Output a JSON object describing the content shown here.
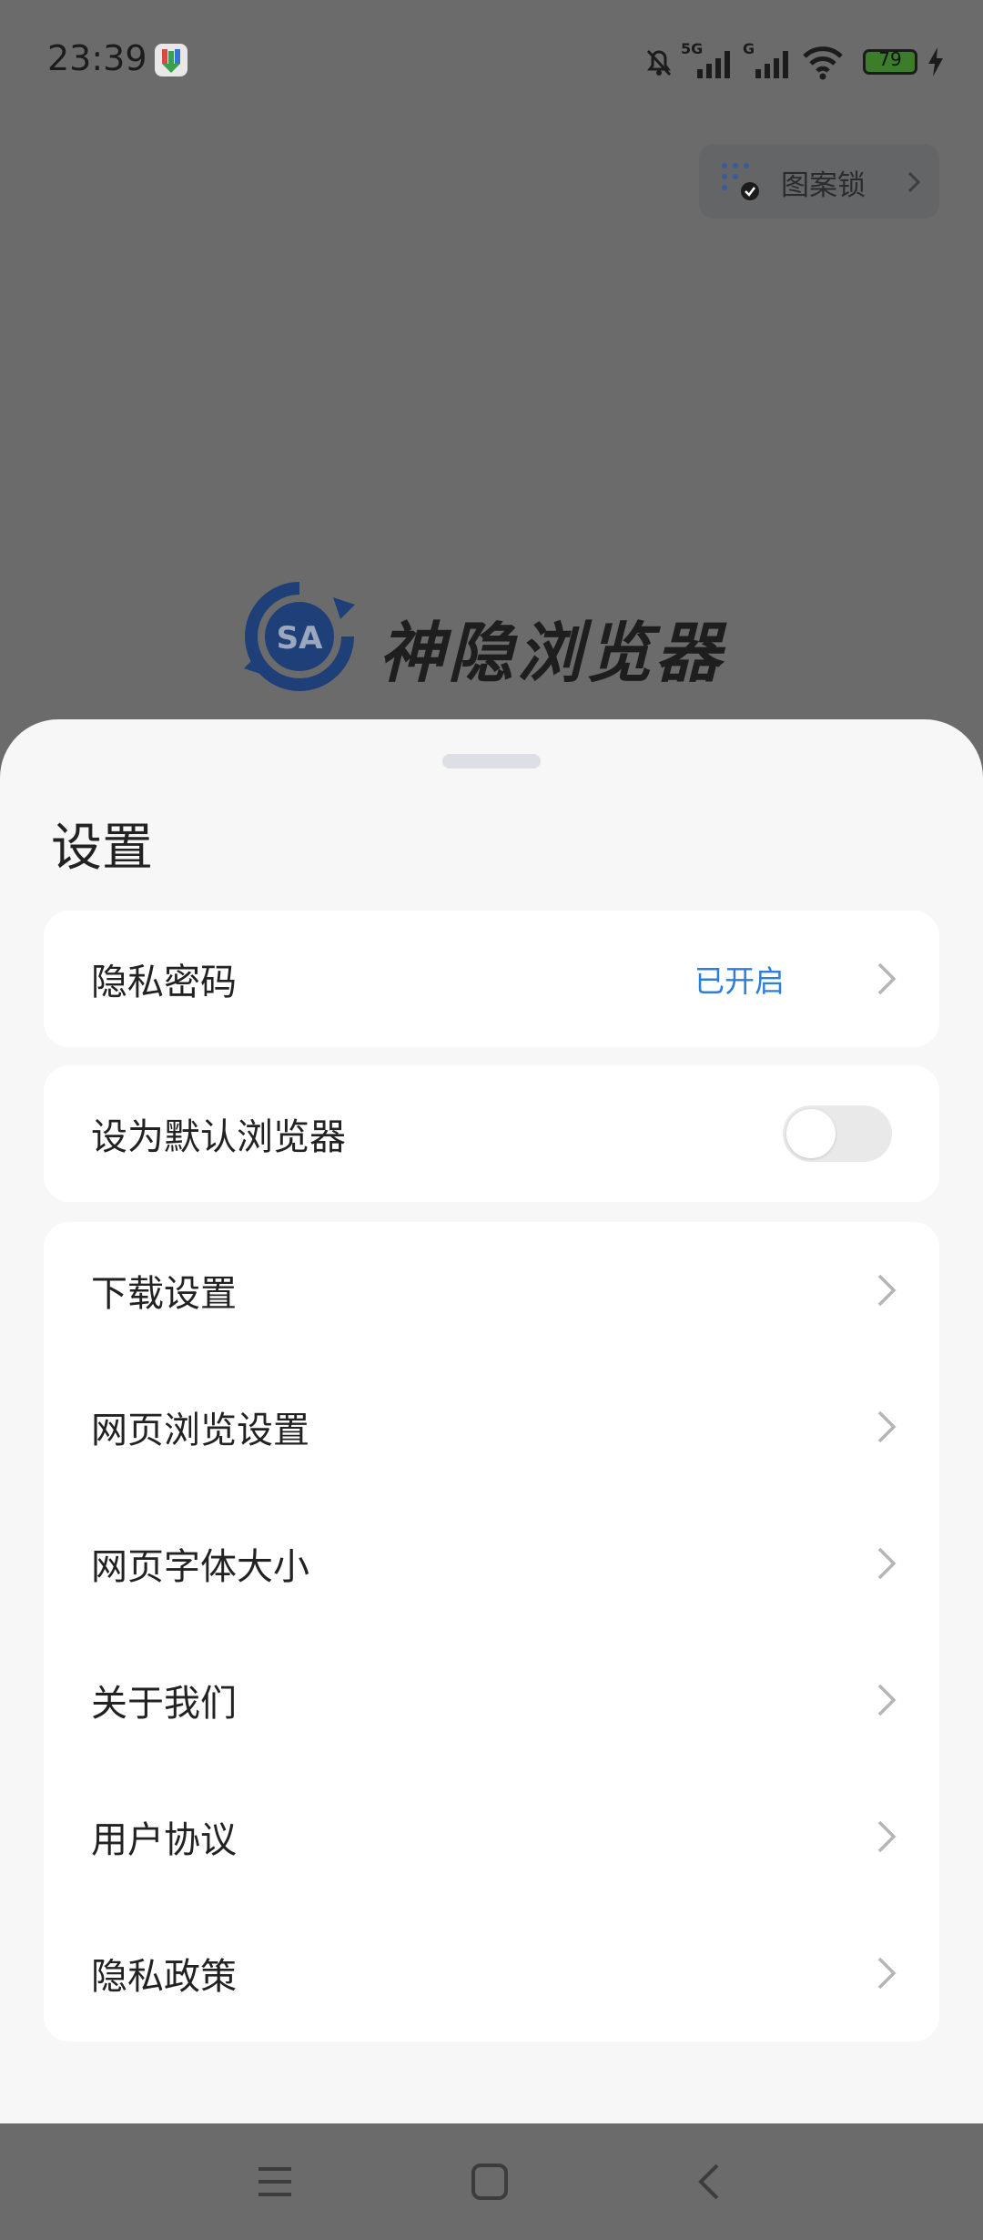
{
  "status_bar": {
    "time": "23:39",
    "battery": "79",
    "network_1": "5G",
    "network_2": "G",
    "icons": [
      "app-notification-icon",
      "mute-bell-icon",
      "signal-5g-icon",
      "signal-g-icon",
      "wifi-icon",
      "battery-icon",
      "charging-icon"
    ]
  },
  "background_app": {
    "pattern_lock_label": "图案锁",
    "logo_text": "神隐浏览器",
    "logo_badge": "SA"
  },
  "sheet": {
    "title": "设置",
    "privacy_password": {
      "label": "隐私密码",
      "value": "已开启"
    },
    "default_browser": {
      "label": "设为默认浏览器",
      "enabled": false
    },
    "items": [
      {
        "label": "下载设置"
      },
      {
        "label": "网页浏览设置"
      },
      {
        "label": "网页字体大小"
      },
      {
        "label": "关于我们"
      },
      {
        "label": "用户协议"
      },
      {
        "label": "隐私政策"
      }
    ]
  },
  "nav_bar": {
    "icons": [
      "menu-icon",
      "home-icon",
      "back-icon"
    ]
  },
  "colors": {
    "accent": "#2f7fd8",
    "sheet_bg": "#f7f7f7",
    "scrim": "#6b6b6b"
  }
}
